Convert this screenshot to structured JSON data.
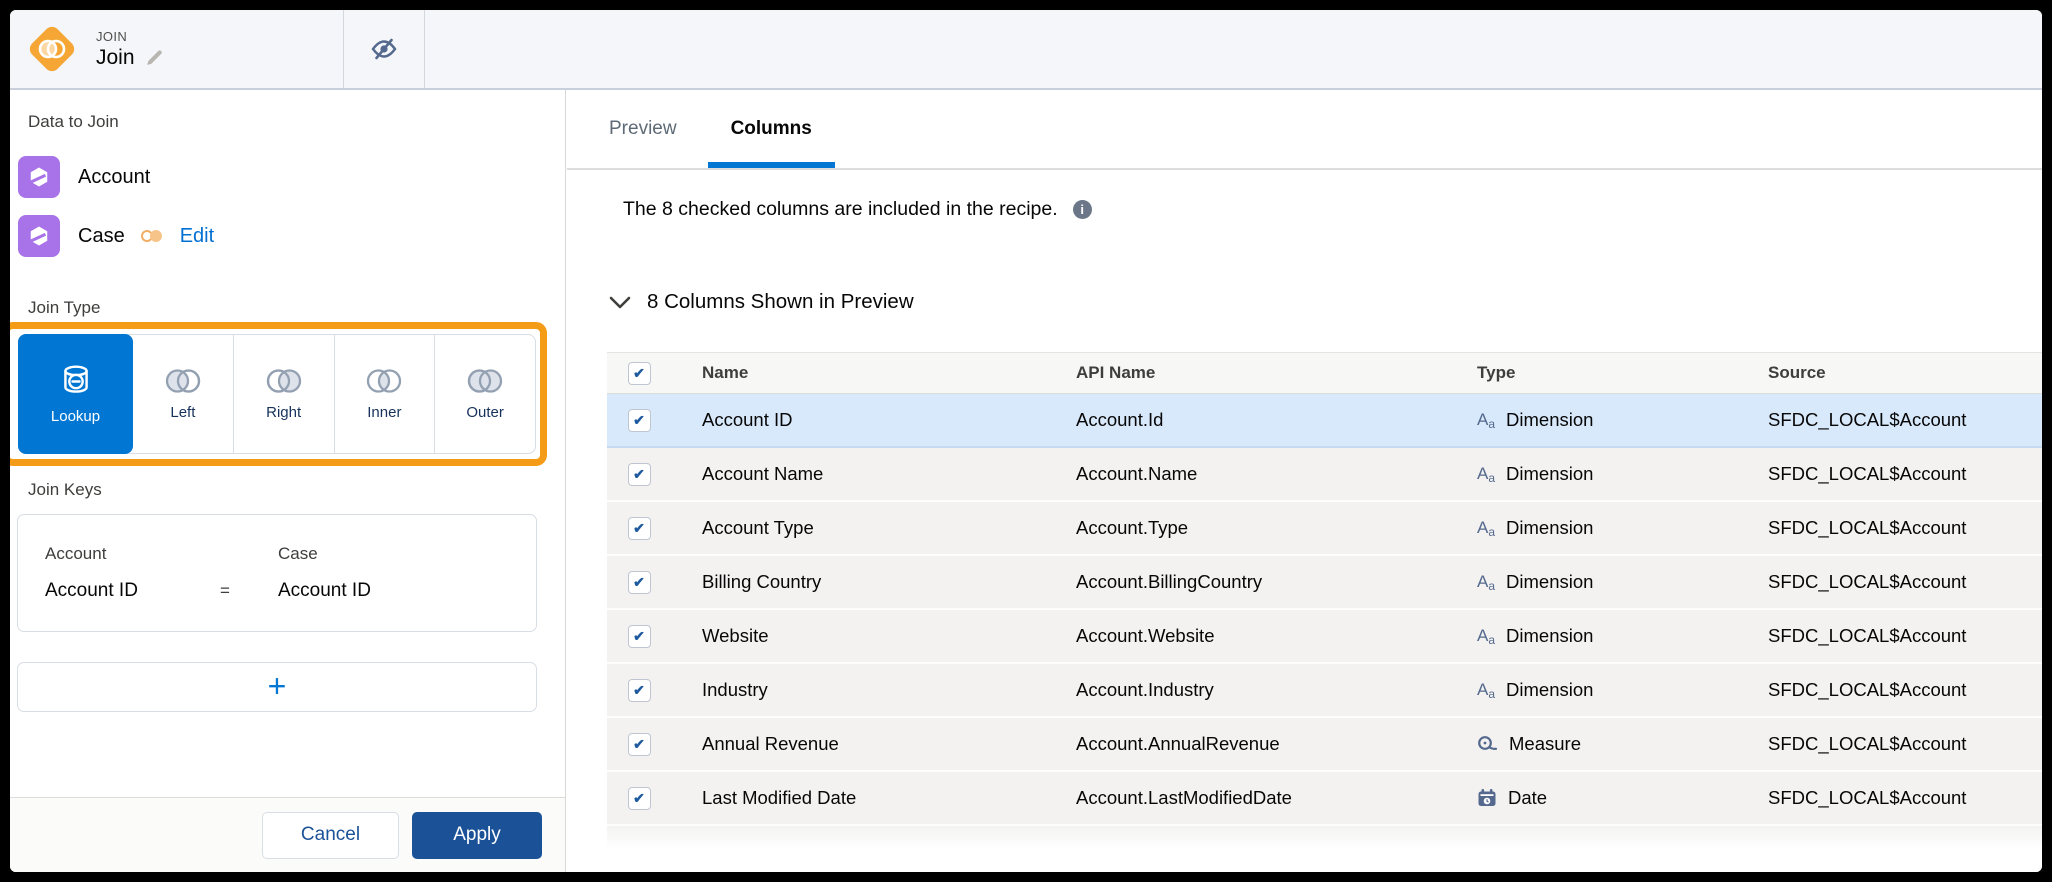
{
  "node_header": {
    "type_label": "JOIN",
    "title": "Join"
  },
  "left_panel": {
    "data_to_join_label": "Data to Join",
    "datasets": [
      {
        "name": "Account"
      },
      {
        "name": "Case",
        "edit_label": "Edit"
      }
    ],
    "join_type_label": "Join Type",
    "join_types": [
      {
        "label": "Lookup",
        "selected": true
      },
      {
        "label": "Left",
        "selected": false
      },
      {
        "label": "Right",
        "selected": false
      },
      {
        "label": "Inner",
        "selected": false
      },
      {
        "label": "Outer",
        "selected": false
      }
    ],
    "join_keys_label": "Join Keys",
    "join_key": {
      "left_object": "Account",
      "left_field": "Account ID",
      "operator": "=",
      "right_object": "Case",
      "right_field": "Account ID"
    },
    "add_key_label": "+",
    "cancel_label": "Cancel",
    "apply_label": "Apply"
  },
  "right_panel": {
    "tabs": [
      {
        "label": "Preview",
        "active": false
      },
      {
        "label": "Columns",
        "active": true
      }
    ],
    "info_text": "The 8 checked columns are included in the recipe.",
    "section_header": "8 Columns Shown in Preview",
    "table": {
      "headers": [
        "Name",
        "API Name",
        "Type",
        "Source"
      ],
      "rows": [
        {
          "name": "Account ID",
          "api_name": "Account.Id",
          "type": "Dimension",
          "type_icon": "dimension",
          "source": "SFDC_LOCAL$Account",
          "checked": true,
          "highlighted": true
        },
        {
          "name": "Account Name",
          "api_name": "Account.Name",
          "type": "Dimension",
          "type_icon": "dimension",
          "source": "SFDC_LOCAL$Account",
          "checked": true,
          "highlighted": false
        },
        {
          "name": "Account Type",
          "api_name": "Account.Type",
          "type": "Dimension",
          "type_icon": "dimension",
          "source": "SFDC_LOCAL$Account",
          "checked": true,
          "highlighted": false
        },
        {
          "name": "Billing Country",
          "api_name": "Account.BillingCountry",
          "type": "Dimension",
          "type_icon": "dimension",
          "source": "SFDC_LOCAL$Account",
          "checked": true,
          "highlighted": false
        },
        {
          "name": "Website",
          "api_name": "Account.Website",
          "type": "Dimension",
          "type_icon": "dimension",
          "source": "SFDC_LOCAL$Account",
          "checked": true,
          "highlighted": false
        },
        {
          "name": "Industry",
          "api_name": "Account.Industry",
          "type": "Dimension",
          "type_icon": "dimension",
          "source": "SFDC_LOCAL$Account",
          "checked": true,
          "highlighted": false
        },
        {
          "name": "Annual Revenue",
          "api_name": "Account.AnnualRevenue",
          "type": "Measure",
          "type_icon": "measure",
          "source": "SFDC_LOCAL$Account",
          "checked": true,
          "highlighted": false
        },
        {
          "name": "Last Modified Date",
          "api_name": "Account.LastModifiedDate",
          "type": "Date",
          "type_icon": "date",
          "source": "SFDC_LOCAL$Account",
          "checked": true,
          "highlighted": false
        }
      ]
    }
  },
  "colors": {
    "accent_orange": "#F49C17",
    "node_orange": "#F5A634",
    "dataset_purple": "#A873E8",
    "brand_blue": "#0176D3",
    "link_blue": "#0170D2",
    "apply_blue": "#1B5297",
    "row_highlight_blue": "#D8E9FB",
    "icon_slate": "#54698D"
  }
}
